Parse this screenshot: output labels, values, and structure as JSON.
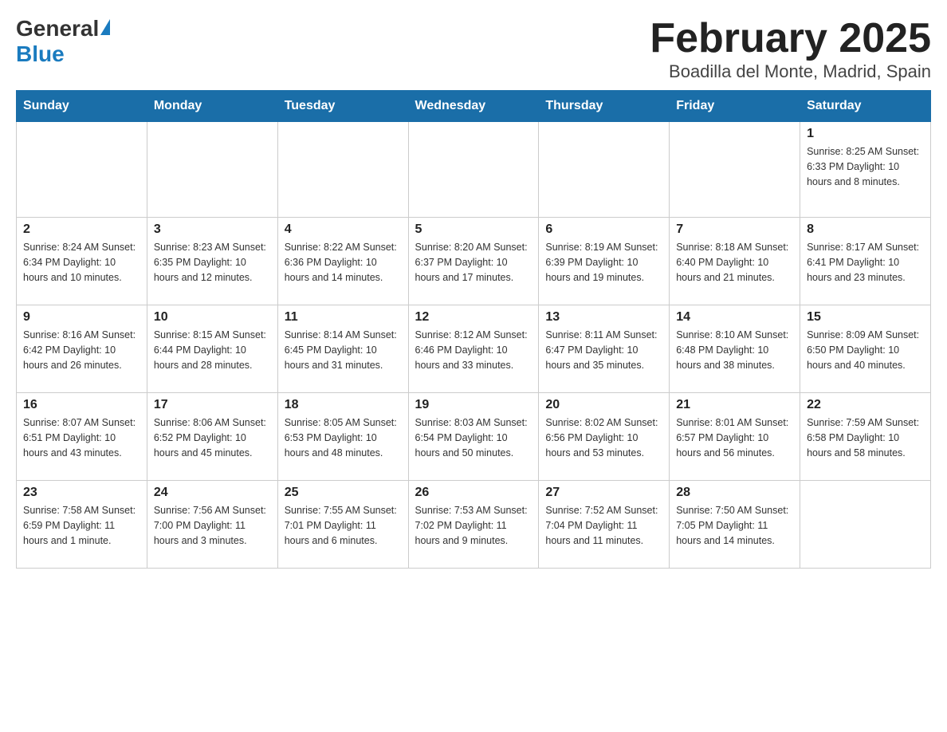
{
  "header": {
    "logo": {
      "general": "General",
      "blue": "Blue"
    },
    "title": "February 2025",
    "subtitle": "Boadilla del Monte, Madrid, Spain"
  },
  "days_of_week": [
    "Sunday",
    "Monday",
    "Tuesday",
    "Wednesday",
    "Thursday",
    "Friday",
    "Saturday"
  ],
  "weeks": [
    [
      {
        "day": "",
        "info": ""
      },
      {
        "day": "",
        "info": ""
      },
      {
        "day": "",
        "info": ""
      },
      {
        "day": "",
        "info": ""
      },
      {
        "day": "",
        "info": ""
      },
      {
        "day": "",
        "info": ""
      },
      {
        "day": "1",
        "info": "Sunrise: 8:25 AM\nSunset: 6:33 PM\nDaylight: 10 hours and 8 minutes."
      }
    ],
    [
      {
        "day": "2",
        "info": "Sunrise: 8:24 AM\nSunset: 6:34 PM\nDaylight: 10 hours and 10 minutes."
      },
      {
        "day": "3",
        "info": "Sunrise: 8:23 AM\nSunset: 6:35 PM\nDaylight: 10 hours and 12 minutes."
      },
      {
        "day": "4",
        "info": "Sunrise: 8:22 AM\nSunset: 6:36 PM\nDaylight: 10 hours and 14 minutes."
      },
      {
        "day": "5",
        "info": "Sunrise: 8:20 AM\nSunset: 6:37 PM\nDaylight: 10 hours and 17 minutes."
      },
      {
        "day": "6",
        "info": "Sunrise: 8:19 AM\nSunset: 6:39 PM\nDaylight: 10 hours and 19 minutes."
      },
      {
        "day": "7",
        "info": "Sunrise: 8:18 AM\nSunset: 6:40 PM\nDaylight: 10 hours and 21 minutes."
      },
      {
        "day": "8",
        "info": "Sunrise: 8:17 AM\nSunset: 6:41 PM\nDaylight: 10 hours and 23 minutes."
      }
    ],
    [
      {
        "day": "9",
        "info": "Sunrise: 8:16 AM\nSunset: 6:42 PM\nDaylight: 10 hours and 26 minutes."
      },
      {
        "day": "10",
        "info": "Sunrise: 8:15 AM\nSunset: 6:44 PM\nDaylight: 10 hours and 28 minutes."
      },
      {
        "day": "11",
        "info": "Sunrise: 8:14 AM\nSunset: 6:45 PM\nDaylight: 10 hours and 31 minutes."
      },
      {
        "day": "12",
        "info": "Sunrise: 8:12 AM\nSunset: 6:46 PM\nDaylight: 10 hours and 33 minutes."
      },
      {
        "day": "13",
        "info": "Sunrise: 8:11 AM\nSunset: 6:47 PM\nDaylight: 10 hours and 35 minutes."
      },
      {
        "day": "14",
        "info": "Sunrise: 8:10 AM\nSunset: 6:48 PM\nDaylight: 10 hours and 38 minutes."
      },
      {
        "day": "15",
        "info": "Sunrise: 8:09 AM\nSunset: 6:50 PM\nDaylight: 10 hours and 40 minutes."
      }
    ],
    [
      {
        "day": "16",
        "info": "Sunrise: 8:07 AM\nSunset: 6:51 PM\nDaylight: 10 hours and 43 minutes."
      },
      {
        "day": "17",
        "info": "Sunrise: 8:06 AM\nSunset: 6:52 PM\nDaylight: 10 hours and 45 minutes."
      },
      {
        "day": "18",
        "info": "Sunrise: 8:05 AM\nSunset: 6:53 PM\nDaylight: 10 hours and 48 minutes."
      },
      {
        "day": "19",
        "info": "Sunrise: 8:03 AM\nSunset: 6:54 PM\nDaylight: 10 hours and 50 minutes."
      },
      {
        "day": "20",
        "info": "Sunrise: 8:02 AM\nSunset: 6:56 PM\nDaylight: 10 hours and 53 minutes."
      },
      {
        "day": "21",
        "info": "Sunrise: 8:01 AM\nSunset: 6:57 PM\nDaylight: 10 hours and 56 minutes."
      },
      {
        "day": "22",
        "info": "Sunrise: 7:59 AM\nSunset: 6:58 PM\nDaylight: 10 hours and 58 minutes."
      }
    ],
    [
      {
        "day": "23",
        "info": "Sunrise: 7:58 AM\nSunset: 6:59 PM\nDaylight: 11 hours and 1 minute."
      },
      {
        "day": "24",
        "info": "Sunrise: 7:56 AM\nSunset: 7:00 PM\nDaylight: 11 hours and 3 minutes."
      },
      {
        "day": "25",
        "info": "Sunrise: 7:55 AM\nSunset: 7:01 PM\nDaylight: 11 hours and 6 minutes."
      },
      {
        "day": "26",
        "info": "Sunrise: 7:53 AM\nSunset: 7:02 PM\nDaylight: 11 hours and 9 minutes."
      },
      {
        "day": "27",
        "info": "Sunrise: 7:52 AM\nSunset: 7:04 PM\nDaylight: 11 hours and 11 minutes."
      },
      {
        "day": "28",
        "info": "Sunrise: 7:50 AM\nSunset: 7:05 PM\nDaylight: 11 hours and 14 minutes."
      },
      {
        "day": "",
        "info": ""
      }
    ]
  ]
}
